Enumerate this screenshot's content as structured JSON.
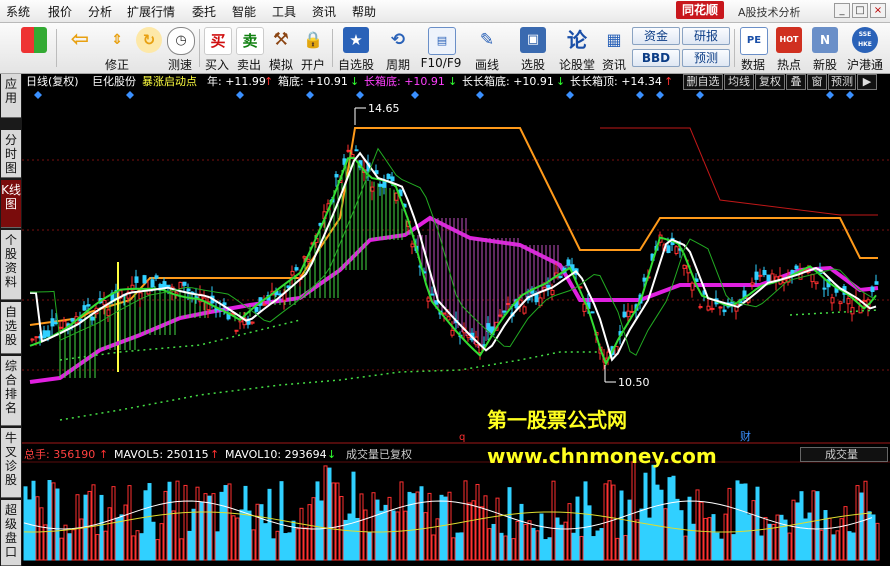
{
  "menu": [
    "系统",
    "报价",
    "分析",
    "扩展行情",
    "委托",
    "智能",
    "工具",
    "资讯",
    "帮助"
  ],
  "brand": {
    "logo": "同花顺",
    "subtitle": "A股技术分析"
  },
  "window_buttons": [
    "_",
    "□",
    "×"
  ],
  "toolbar": {
    "items": [
      {
        "label": "",
        "icon": "color-grid-icon"
      },
      {
        "label": "",
        "icon": "back-arrow-icon"
      },
      {
        "label": "修正",
        "icon": "up-down-arrow-icon"
      },
      {
        "label": "测速",
        "icon": "clock-icon"
      },
      {
        "label": "买入",
        "icon": "buy-icon",
        "glyph": "买"
      },
      {
        "label": "卖出",
        "icon": "sell-icon",
        "glyph": "卖"
      },
      {
        "label": "模拟",
        "icon": "hammer-icon"
      },
      {
        "label": "开户",
        "icon": "lock-icon"
      },
      {
        "label": "自选股",
        "icon": "star-icon"
      },
      {
        "label": "周期",
        "icon": "cycle-icon"
      },
      {
        "label": "F10/F9",
        "icon": "f10-icon"
      },
      {
        "label": "画线",
        "icon": "pen-icon"
      },
      {
        "label": "选股",
        "icon": "monitor-icon"
      },
      {
        "label": "论股堂",
        "icon": "forum-icon",
        "glyph": "论"
      },
      {
        "label": "资讯",
        "icon": "news-icon"
      },
      {
        "label": "数据",
        "icon": "pe-icon",
        "glyph": "PE"
      },
      {
        "label": "热点",
        "icon": "hot-icon",
        "glyph": "HOT"
      },
      {
        "label": "新股",
        "icon": "newstock-icon",
        "glyph": "N"
      },
      {
        "label": "沪港通",
        "icon": "sse-hk-icon",
        "glyph": "SSE HKE"
      }
    ],
    "pills": {
      "fund": "资金",
      "research": "研报",
      "bbd": "BBD",
      "forecast": "预测"
    }
  },
  "side_tabs": [
    "应用",
    "分时图",
    "K线图",
    "个股资料",
    "自选股",
    "综合排名",
    "牛叉诊股",
    "超级盘口"
  ],
  "side_active_index": 2,
  "chart_header": {
    "period": "日线(复权)",
    "stock": "巨化股份",
    "formula": "暴涨启动点",
    "items": [
      {
        "text": "年: +11.99",
        "arrow": "↑",
        "color": "#ffffff",
        "arrow_color": "#ff3030"
      },
      {
        "text": "箱底: +10.91",
        "arrow": "↓",
        "color": "#ffffff",
        "arrow_color": "#30ff30"
      },
      {
        "text": "长箱底: +10.91",
        "arrow": "↓",
        "color": "#ff40ff",
        "arrow_color": "#30ff30"
      },
      {
        "text": "长长箱底: +10.91",
        "arrow": "↓",
        "color": "#ffffff",
        "arrow_color": "#30ff30"
      },
      {
        "text": "长长箱顶: +14.34",
        "arrow": "↑",
        "color": "#ffffff",
        "arrow_color": "#ff3030"
      }
    ]
  },
  "right_buttons": [
    "删自选",
    "均线",
    "复权",
    "叠",
    "窗",
    "预测",
    "▶"
  ],
  "price_labels": {
    "high": "14.65",
    "low": "10.50"
  },
  "markers": {
    "q": "q",
    "cai": "财"
  },
  "volume_header": {
    "total": "总手: 356190",
    "total_arrow": "↑",
    "mavol5": "MAVOL5: 250115",
    "mavol5_arrow": "↑",
    "mavol10": "MAVOL10: 293694",
    "mavol10_arrow": "↓",
    "note": "成交量已复权"
  },
  "volume_select": "成交量",
  "watermark": {
    "cn": "第一股票公式网",
    "url": "www.chnmoney.com"
  },
  "colors": {
    "up": "#ff3030",
    "down": "#30d0ff",
    "ma_white": "#ffffff",
    "ma_green": "#33dd33",
    "box_orange": "#ff9a1a",
    "box_magenta": "#e020e0",
    "box_red": "#c01818"
  }
}
